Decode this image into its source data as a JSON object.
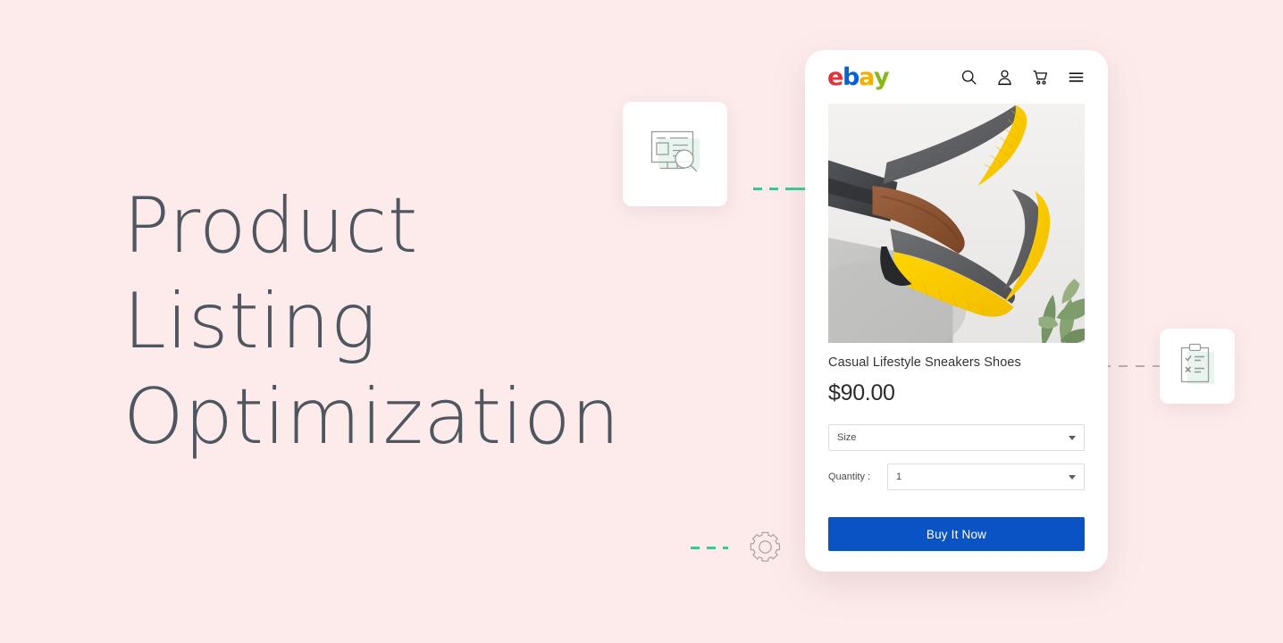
{
  "page": {
    "background_color": "#fdebeb",
    "headline_color": "#4e565f",
    "accent_green": "#54bfa0",
    "accent_blue": "#0a53c4"
  },
  "headline": {
    "line1": "Product",
    "line2": "Listing",
    "line3": "Optimization"
  },
  "decor": {
    "monitor_card_icon": "monitor-search-icon",
    "clipboard_card_icon": "clipboard-checklist-icon",
    "gear_icon": "gear-icon",
    "connector_left": "dashed-green-connector",
    "connector_right": "dashed-gray-connector",
    "connector_gear": "dashed-green-connector"
  },
  "phone": {
    "brand": {
      "name": "ebay",
      "letters": [
        {
          "char": "e",
          "color": "#e53238"
        },
        {
          "char": "b",
          "color": "#0064d2"
        },
        {
          "char": "a",
          "color": "#f5af02"
        },
        {
          "char": "y",
          "color": "#86b817"
        }
      ]
    },
    "header_icons": [
      {
        "name": "search-icon",
        "label": "Search"
      },
      {
        "name": "account-icon",
        "label": "My eBay"
      },
      {
        "name": "cart-icon",
        "label": "Cart"
      },
      {
        "name": "menu-icon",
        "label": "Menu"
      }
    ],
    "product": {
      "image_alt": "Gray felt slip-on sneakers with yellow soles worn with dark jeans",
      "title": "Casual Lifestyle Sneakers Shoes",
      "price": "$90.00",
      "size_select": {
        "value": "Size",
        "options": [
          "Size"
        ]
      },
      "quantity": {
        "label": "Quantity :",
        "value": "1",
        "options": [
          "1"
        ]
      },
      "buy_button": "Buy It Now"
    }
  }
}
